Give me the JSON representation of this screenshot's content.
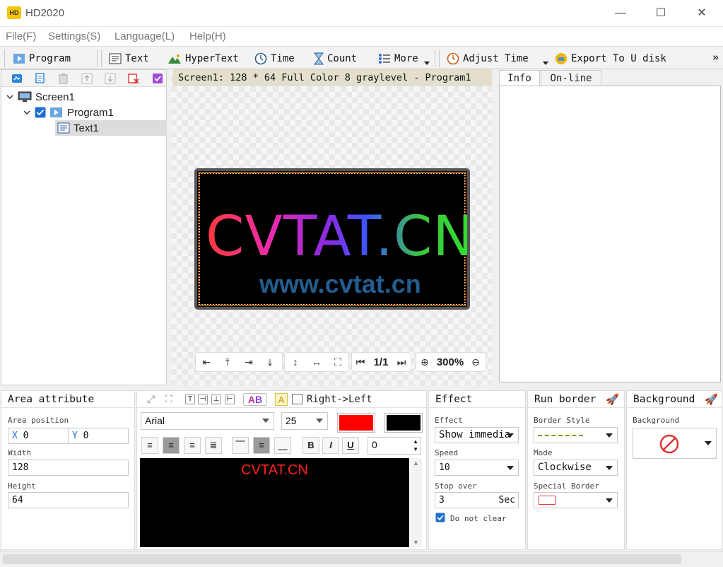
{
  "app": {
    "title": "HD2020",
    "logo_text": "HD"
  },
  "window_controls": {
    "minimize": "—",
    "maximize": "☐",
    "close": "✕"
  },
  "menu": [
    "File(F)",
    "Settings(S)",
    "Language(L)",
    "Help(H)"
  ],
  "toolbar": {
    "program": "Program",
    "text": "Text",
    "hypertext": "HyperText",
    "time": "Time",
    "count": "Count",
    "more": "More",
    "adjust_time": "Adjust Time",
    "export": "Export To U disk",
    "overflow": "»"
  },
  "tree": {
    "screen": "Screen1",
    "program": "Program1",
    "text": "Text1"
  },
  "canvas": {
    "info_bar": "Screen1: 128 * 64 Full Color 8 graylevel - Program1",
    "led_line1": "CVTAT.CN",
    "led_line2": "www.cvtat.cn",
    "page": "1/1",
    "zoom": "300%"
  },
  "right_tabs": {
    "info": "Info",
    "online": "On-line"
  },
  "area": {
    "title": "Area attribute",
    "position_label": "Area position",
    "x_label": "X",
    "x_value": "0",
    "y_label": "Y",
    "y_value": "0",
    "width_label": "Width",
    "width_value": "128",
    "height_label": "Height",
    "height_value": "64"
  },
  "text_edit": {
    "direction_label": "Right->Left",
    "font": "Arial",
    "size": "25",
    "spacing": "0",
    "content": "CVTAT.CN",
    "fg_color": "#ff0000",
    "bg_color": "#000000",
    "bold": "B",
    "italic": "I",
    "underline": "U",
    "ab_label": "AB",
    "a_label": "A"
  },
  "effect": {
    "title": "Effect",
    "effect_label": "Effect",
    "effect_value": "Show immedia",
    "speed_label": "Speed",
    "speed_value": "10",
    "stop_label": "Stop over",
    "stop_value": "3",
    "stop_unit": "Sec",
    "do_not_clear": "Do not clear"
  },
  "run_border": {
    "title": "Run border",
    "style_label": "Border Style",
    "mode_label": "Mode",
    "mode_value": "Clockwise",
    "special_label": "Special Border"
  },
  "background": {
    "title": "Background",
    "label": "Background"
  }
}
